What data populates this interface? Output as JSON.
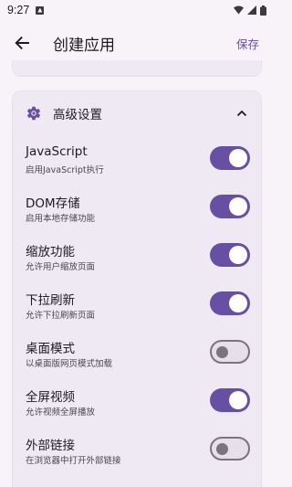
{
  "status_bar": {
    "time": "9:27"
  },
  "app_bar": {
    "title": "创建应用",
    "save_label": "保存"
  },
  "advanced_section": {
    "title": "高级设置",
    "settings": [
      {
        "label": "JavaScript",
        "desc": "启用JavaScript执行",
        "enabled": true
      },
      {
        "label": "DOM存储",
        "desc": "启用本地存储功能",
        "enabled": true
      },
      {
        "label": "缩放功能",
        "desc": "允许用户缩放页面",
        "enabled": true
      },
      {
        "label": "下拉刷新",
        "desc": "允许下拉刷新页面",
        "enabled": true
      },
      {
        "label": "桌面模式",
        "desc": "以桌面版网页模式加载",
        "enabled": false
      },
      {
        "label": "全屏视频",
        "desc": "允许视频全屏播放",
        "enabled": true
      },
      {
        "label": "外部链接",
        "desc": "在浏览器中打开外部链接",
        "enabled": false
      }
    ]
  },
  "colors": {
    "accent": "#6750a4",
    "surface": "#efe9f3",
    "background": "#f7f3f9"
  }
}
